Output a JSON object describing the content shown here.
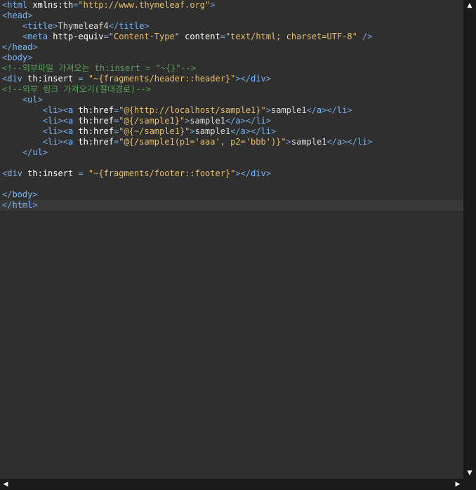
{
  "editor": {
    "lines": [
      [
        [
          "punc",
          "<"
        ],
        [
          "tag",
          "html"
        ],
        [
          "text",
          " "
        ],
        [
          "attr",
          "xmlns:th"
        ],
        [
          "punc",
          "="
        ],
        [
          "str",
          "\"http://www.thymeleaf.org\""
        ],
        [
          "punc",
          ">"
        ]
      ],
      [
        [
          "punc",
          "<"
        ],
        [
          "tag",
          "head"
        ],
        [
          "punc",
          ">"
        ]
      ],
      [
        [
          "text",
          "    "
        ],
        [
          "punc",
          "<"
        ],
        [
          "tag",
          "title"
        ],
        [
          "punc",
          ">"
        ],
        [
          "text",
          "Thymeleaf4"
        ],
        [
          "punc",
          "</"
        ],
        [
          "tag",
          "title"
        ],
        [
          "punc",
          ">"
        ]
      ],
      [
        [
          "text",
          "    "
        ],
        [
          "punc",
          "<"
        ],
        [
          "tag",
          "meta"
        ],
        [
          "text",
          " "
        ],
        [
          "attr",
          "http-equiv"
        ],
        [
          "punc",
          "="
        ],
        [
          "str",
          "\"Content-Type\""
        ],
        [
          "text",
          " "
        ],
        [
          "attr",
          "content"
        ],
        [
          "punc",
          "="
        ],
        [
          "str",
          "\"text/html; charset=UTF-8\""
        ],
        [
          "text",
          " "
        ],
        [
          "punc",
          "/>"
        ]
      ],
      [
        [
          "punc",
          "</"
        ],
        [
          "tag",
          "head"
        ],
        [
          "punc",
          ">"
        ]
      ],
      [
        [
          "punc",
          "<"
        ],
        [
          "tag",
          "body"
        ],
        [
          "punc",
          ">"
        ]
      ],
      [
        [
          "comment",
          "<!--외부파일 가져오는 th:insert = \"~{}\"-->"
        ]
      ],
      [
        [
          "punc",
          "<"
        ],
        [
          "tag",
          "div"
        ],
        [
          "text",
          " "
        ],
        [
          "attr",
          "th:insert"
        ],
        [
          "text",
          " "
        ],
        [
          "punc",
          "="
        ],
        [
          "text",
          " "
        ],
        [
          "str",
          "\"~{fragments/header::header}\""
        ],
        [
          "punc",
          "></"
        ],
        [
          "tag",
          "div"
        ],
        [
          "punc",
          ">"
        ]
      ],
      [
        [
          "comment",
          "<!--외부 링크 가져오기(절대경로)-->"
        ]
      ],
      [
        [
          "text",
          "    "
        ],
        [
          "punc",
          "<"
        ],
        [
          "tag",
          "ul"
        ],
        [
          "punc",
          ">"
        ]
      ],
      [
        [
          "text",
          "        "
        ],
        [
          "punc",
          "<"
        ],
        [
          "tag",
          "li"
        ],
        [
          "punc",
          "><"
        ],
        [
          "tag",
          "a"
        ],
        [
          "text",
          " "
        ],
        [
          "attr",
          "th:href"
        ],
        [
          "punc",
          "="
        ],
        [
          "str",
          "\"@{http://localhost/sample1}\""
        ],
        [
          "punc",
          ">"
        ],
        [
          "text",
          "sample1"
        ],
        [
          "punc",
          "</"
        ],
        [
          "tag",
          "a"
        ],
        [
          "punc",
          "></"
        ],
        [
          "tag",
          "li"
        ],
        [
          "punc",
          ">"
        ]
      ],
      [
        [
          "text",
          "        "
        ],
        [
          "punc",
          "<"
        ],
        [
          "tag",
          "li"
        ],
        [
          "punc",
          "><"
        ],
        [
          "tag",
          "a"
        ],
        [
          "text",
          " "
        ],
        [
          "attr",
          "th:href"
        ],
        [
          "punc",
          "="
        ],
        [
          "str",
          "\"@{/sample1}\""
        ],
        [
          "punc",
          ">"
        ],
        [
          "text",
          "sample1"
        ],
        [
          "punc",
          "</"
        ],
        [
          "tag",
          "a"
        ],
        [
          "punc",
          "></"
        ],
        [
          "tag",
          "li"
        ],
        [
          "punc",
          ">"
        ]
      ],
      [
        [
          "text",
          "        "
        ],
        [
          "punc",
          "<"
        ],
        [
          "tag",
          "li"
        ],
        [
          "punc",
          "><"
        ],
        [
          "tag",
          "a"
        ],
        [
          "text",
          " "
        ],
        [
          "attr",
          "th:href"
        ],
        [
          "punc",
          "="
        ],
        [
          "str",
          "\"@{~/sample1}\""
        ],
        [
          "punc",
          ">"
        ],
        [
          "text",
          "sample1"
        ],
        [
          "punc",
          "</"
        ],
        [
          "tag",
          "a"
        ],
        [
          "punc",
          "></"
        ],
        [
          "tag",
          "li"
        ],
        [
          "punc",
          ">"
        ]
      ],
      [
        [
          "text",
          "        "
        ],
        [
          "punc",
          "<"
        ],
        [
          "tag",
          "li"
        ],
        [
          "punc",
          "><"
        ],
        [
          "tag",
          "a"
        ],
        [
          "text",
          " "
        ],
        [
          "attr",
          "th:href"
        ],
        [
          "punc",
          "="
        ],
        [
          "str",
          "\"@{/sample1(p1='aaa', p2='bbb')}\""
        ],
        [
          "punc",
          ">"
        ],
        [
          "text",
          "sample1"
        ],
        [
          "punc",
          "</"
        ],
        [
          "tag",
          "a"
        ],
        [
          "punc",
          "></"
        ],
        [
          "tag",
          "li"
        ],
        [
          "punc",
          ">"
        ]
      ],
      [
        [
          "text",
          "    "
        ],
        [
          "punc",
          "</"
        ],
        [
          "tag",
          "ul"
        ],
        [
          "punc",
          ">"
        ]
      ],
      [],
      [
        [
          "punc",
          "<"
        ],
        [
          "tag",
          "div"
        ],
        [
          "text",
          " "
        ],
        [
          "attr",
          "th:insert"
        ],
        [
          "text",
          " "
        ],
        [
          "punc",
          "="
        ],
        [
          "text",
          " "
        ],
        [
          "str",
          "\"~{fragments/footer::footer}\""
        ],
        [
          "punc",
          "></"
        ],
        [
          "tag",
          "div"
        ],
        [
          "punc",
          ">"
        ]
      ],
      [],
      [
        [
          "punc",
          "</"
        ],
        [
          "tag",
          "body"
        ],
        [
          "punc",
          ">"
        ]
      ],
      [
        [
          "punc",
          "</"
        ],
        [
          "tag",
          "html"
        ],
        [
          "punc",
          ">"
        ]
      ]
    ],
    "current_line": 19
  },
  "scrollbars": {
    "up_arrow": "▲",
    "down_arrow": "▼",
    "left_arrow": "◀",
    "right_arrow": "▶"
  }
}
